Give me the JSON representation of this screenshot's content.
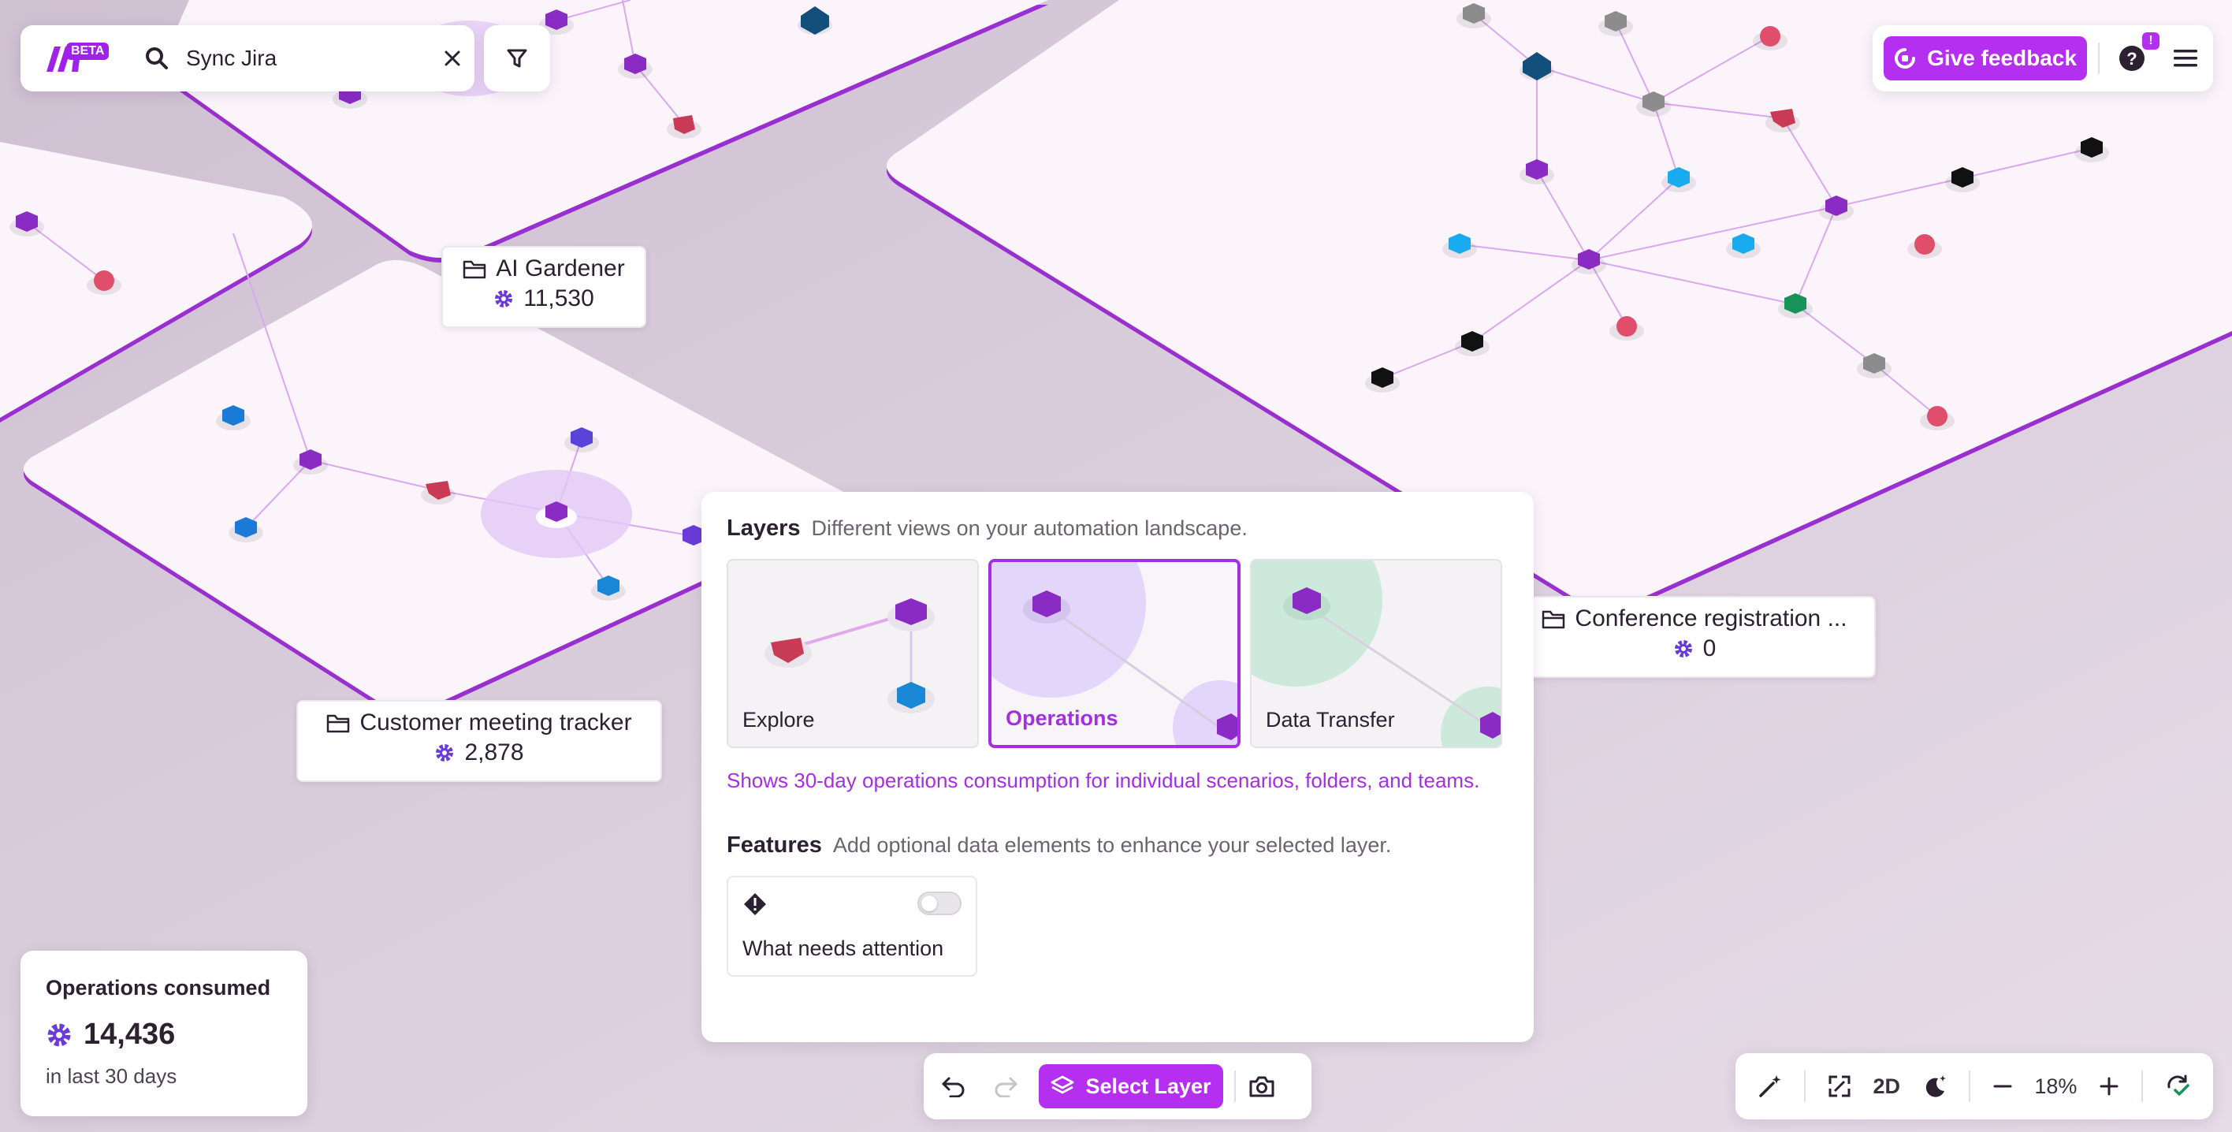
{
  "app": {
    "beta_badge": "BETA",
    "brand_color": "#b52ff0"
  },
  "search": {
    "value": "Sync Jira"
  },
  "header": {
    "feedback_label": "Give feedback",
    "help_badge": "!"
  },
  "folders": [
    {
      "name": "AI Gardener",
      "ops": "11,530"
    },
    {
      "name": "Customer meeting tracker",
      "ops": "2,878"
    },
    {
      "name": "Conference registration ...",
      "ops": "0"
    }
  ],
  "layers_panel": {
    "title": "Layers",
    "subtitle": "Different views on your automation landscape.",
    "layers": [
      {
        "label": "Explore",
        "selected": false
      },
      {
        "label": "Operations",
        "selected": true
      },
      {
        "label": "Data Transfer",
        "selected": false
      }
    ],
    "description": "Shows 30-day operations consumption for individual scenarios, folders, and teams.",
    "features_title": "Features",
    "features_subtitle": "Add optional data elements to enhance your selected layer.",
    "features": [
      {
        "label": "What needs attention",
        "enabled": false
      }
    ]
  },
  "toolbar": {
    "select_layer_label": "Select Layer"
  },
  "ops_summary": {
    "title": "Operations consumed",
    "value": "14,436",
    "period": "in last 30 days"
  },
  "view_controls": {
    "mode_label": "2D",
    "zoom_level": "18%"
  },
  "icons": [
    "search-icon",
    "close-icon",
    "filter-icon",
    "feedback-icon",
    "help-icon",
    "menu-icon",
    "folder-icon",
    "gear-icon",
    "warning-icon",
    "undo-icon",
    "redo-icon",
    "layers-icon",
    "camera-icon",
    "magic-wand-icon",
    "fit-screen-icon",
    "dark-mode-icon",
    "zoom-out-icon",
    "zoom-in-icon",
    "sync-status-icon"
  ]
}
